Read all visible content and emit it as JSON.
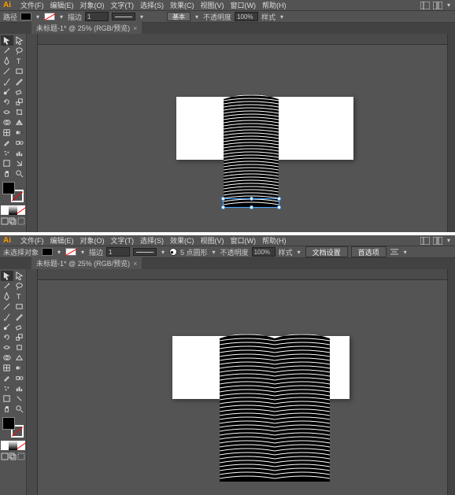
{
  "common": {
    "logo": "Ai",
    "menus": [
      "文件(F)",
      "编辑(E)",
      "对象(O)",
      "文字(T)",
      "选择(S)",
      "效果(C)",
      "视图(V)",
      "窗口(W)",
      "帮助(H)"
    ],
    "opacity_label": "不透明度",
    "opacity_value": "100%",
    "style_label": "样式",
    "stroke_label": "描边",
    "stroke_weight": "1",
    "doc_tab": "未标题-1* @ 25% (RGB/预览)",
    "doc_close": "×"
  },
  "top": {
    "optbar_left": "路径",
    "basic_btn": "基本"
  },
  "bottom": {
    "optbar_left": "未选择对象",
    "round_btn": "5 点圆形",
    "btn_docsetup": "文档设置",
    "btn_prefs": "首选项"
  }
}
